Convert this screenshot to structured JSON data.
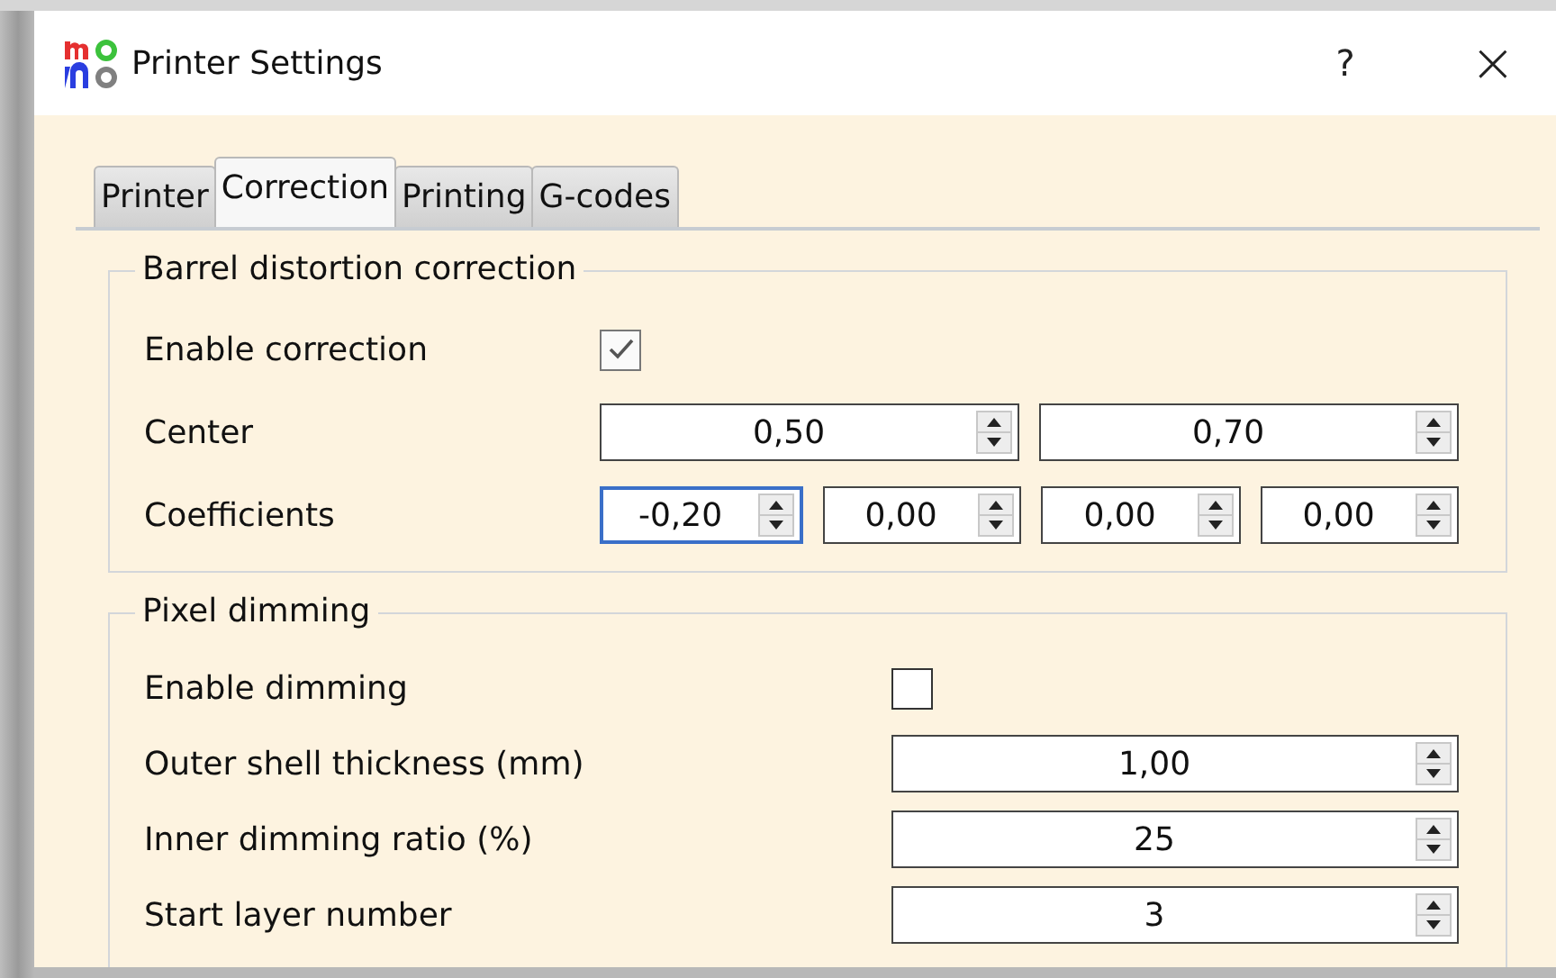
{
  "window": {
    "title": "Printer Settings",
    "help": "?",
    "close": "×"
  },
  "tabs": [
    {
      "label": "Printer",
      "selected": false
    },
    {
      "label": "Correction",
      "selected": true
    },
    {
      "label": "Printing",
      "selected": false
    },
    {
      "label": "G-codes",
      "selected": false
    }
  ],
  "groups": [
    {
      "title": "Barrel distortion correction",
      "rows": [
        {
          "kind": "checkbox",
          "label": "Enable correction",
          "checked": true
        },
        {
          "kind": "spins",
          "label": "Center",
          "fields": [
            {
              "value": "0,50",
              "focused": false
            },
            {
              "value": "0,70",
              "focused": false
            }
          ]
        },
        {
          "kind": "spins",
          "label": "Coefficients",
          "fields": [
            {
              "value": "-0,20",
              "focused": true
            },
            {
              "value": "0,00",
              "focused": false
            },
            {
              "value": "0,00",
              "focused": false
            },
            {
              "value": "0,00",
              "focused": false
            }
          ]
        }
      ]
    },
    {
      "title": "Pixel dimming",
      "rows": [
        {
          "kind": "checkbox",
          "label": "Enable dimming",
          "checked": false
        },
        {
          "kind": "spins",
          "label": "Outer shell thickness (mm)",
          "fields": [
            {
              "value": "1,00",
              "focused": false
            }
          ]
        },
        {
          "kind": "spins",
          "label": "Inner dimming ratio (%)",
          "fields": [
            {
              "value": "25",
              "focused": false
            }
          ]
        },
        {
          "kind": "spins",
          "label": "Start layer number",
          "fields": [
            {
              "value": "3",
              "focused": false
            }
          ]
        }
      ]
    }
  ]
}
